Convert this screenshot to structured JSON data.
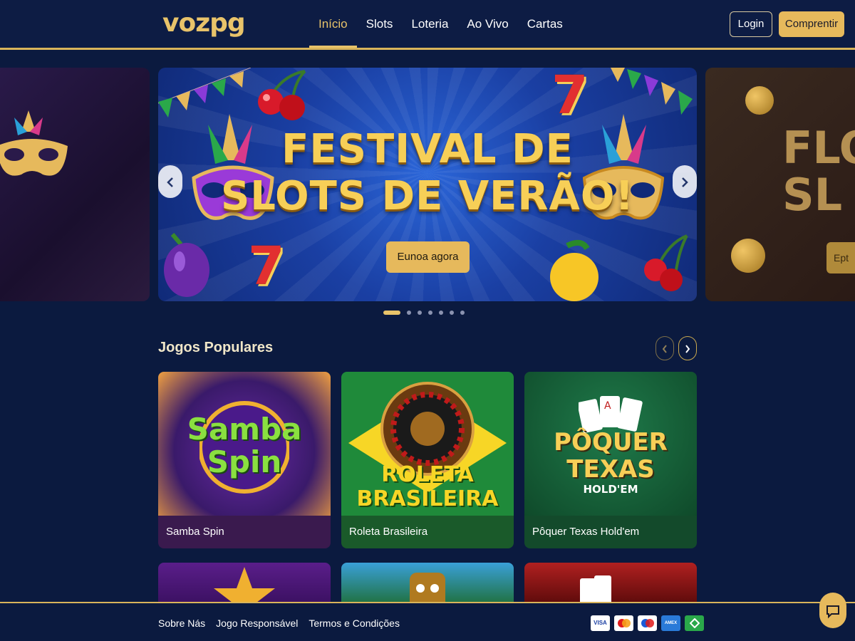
{
  "brand": {
    "logo": "vozpg"
  },
  "nav": {
    "items": [
      {
        "label": "Início",
        "active": true
      },
      {
        "label": "Slots",
        "active": false
      },
      {
        "label": "Loteria",
        "active": false
      },
      {
        "label": "Ao Vivo",
        "active": false
      },
      {
        "label": "Cartas",
        "active": false
      }
    ]
  },
  "header": {
    "login_label": "Login",
    "buy_label": "Comprentir"
  },
  "carousel": {
    "main": {
      "title": "FESTIVAL DE\nSLOTS DE VERÃO!",
      "cta_label": "Eunoa agora"
    },
    "right_preview": {
      "title_fragment": "FLOO\nSL",
      "button_fragment": "Ept"
    },
    "prev_icon": "chevron-left-icon",
    "next_icon": "chevron-right-icon",
    "slide_count": 7,
    "active_index": 0
  },
  "popular": {
    "title": "Jogos Populares",
    "games": [
      {
        "name": "Samba Spin",
        "art_title": "Samba\nSpin"
      },
      {
        "name": "Roleta Brasileira",
        "art_title": "ROLETA\nBRASILEIRA"
      },
      {
        "name": "Pôquer Texas Hold'em",
        "art_title": "PÔQUER\nTEXAS",
        "art_subtitle": "HOLD'EM"
      }
    ]
  },
  "footer": {
    "links": [
      "Sobre Nás",
      "Jogo Responsável",
      "Termos e Condições"
    ],
    "payments": [
      "VISA",
      "MC",
      "MAESTRO",
      "AMEX",
      "PIX"
    ]
  },
  "colors": {
    "accent": "#e6b95c",
    "background": "#0b1a3f"
  }
}
